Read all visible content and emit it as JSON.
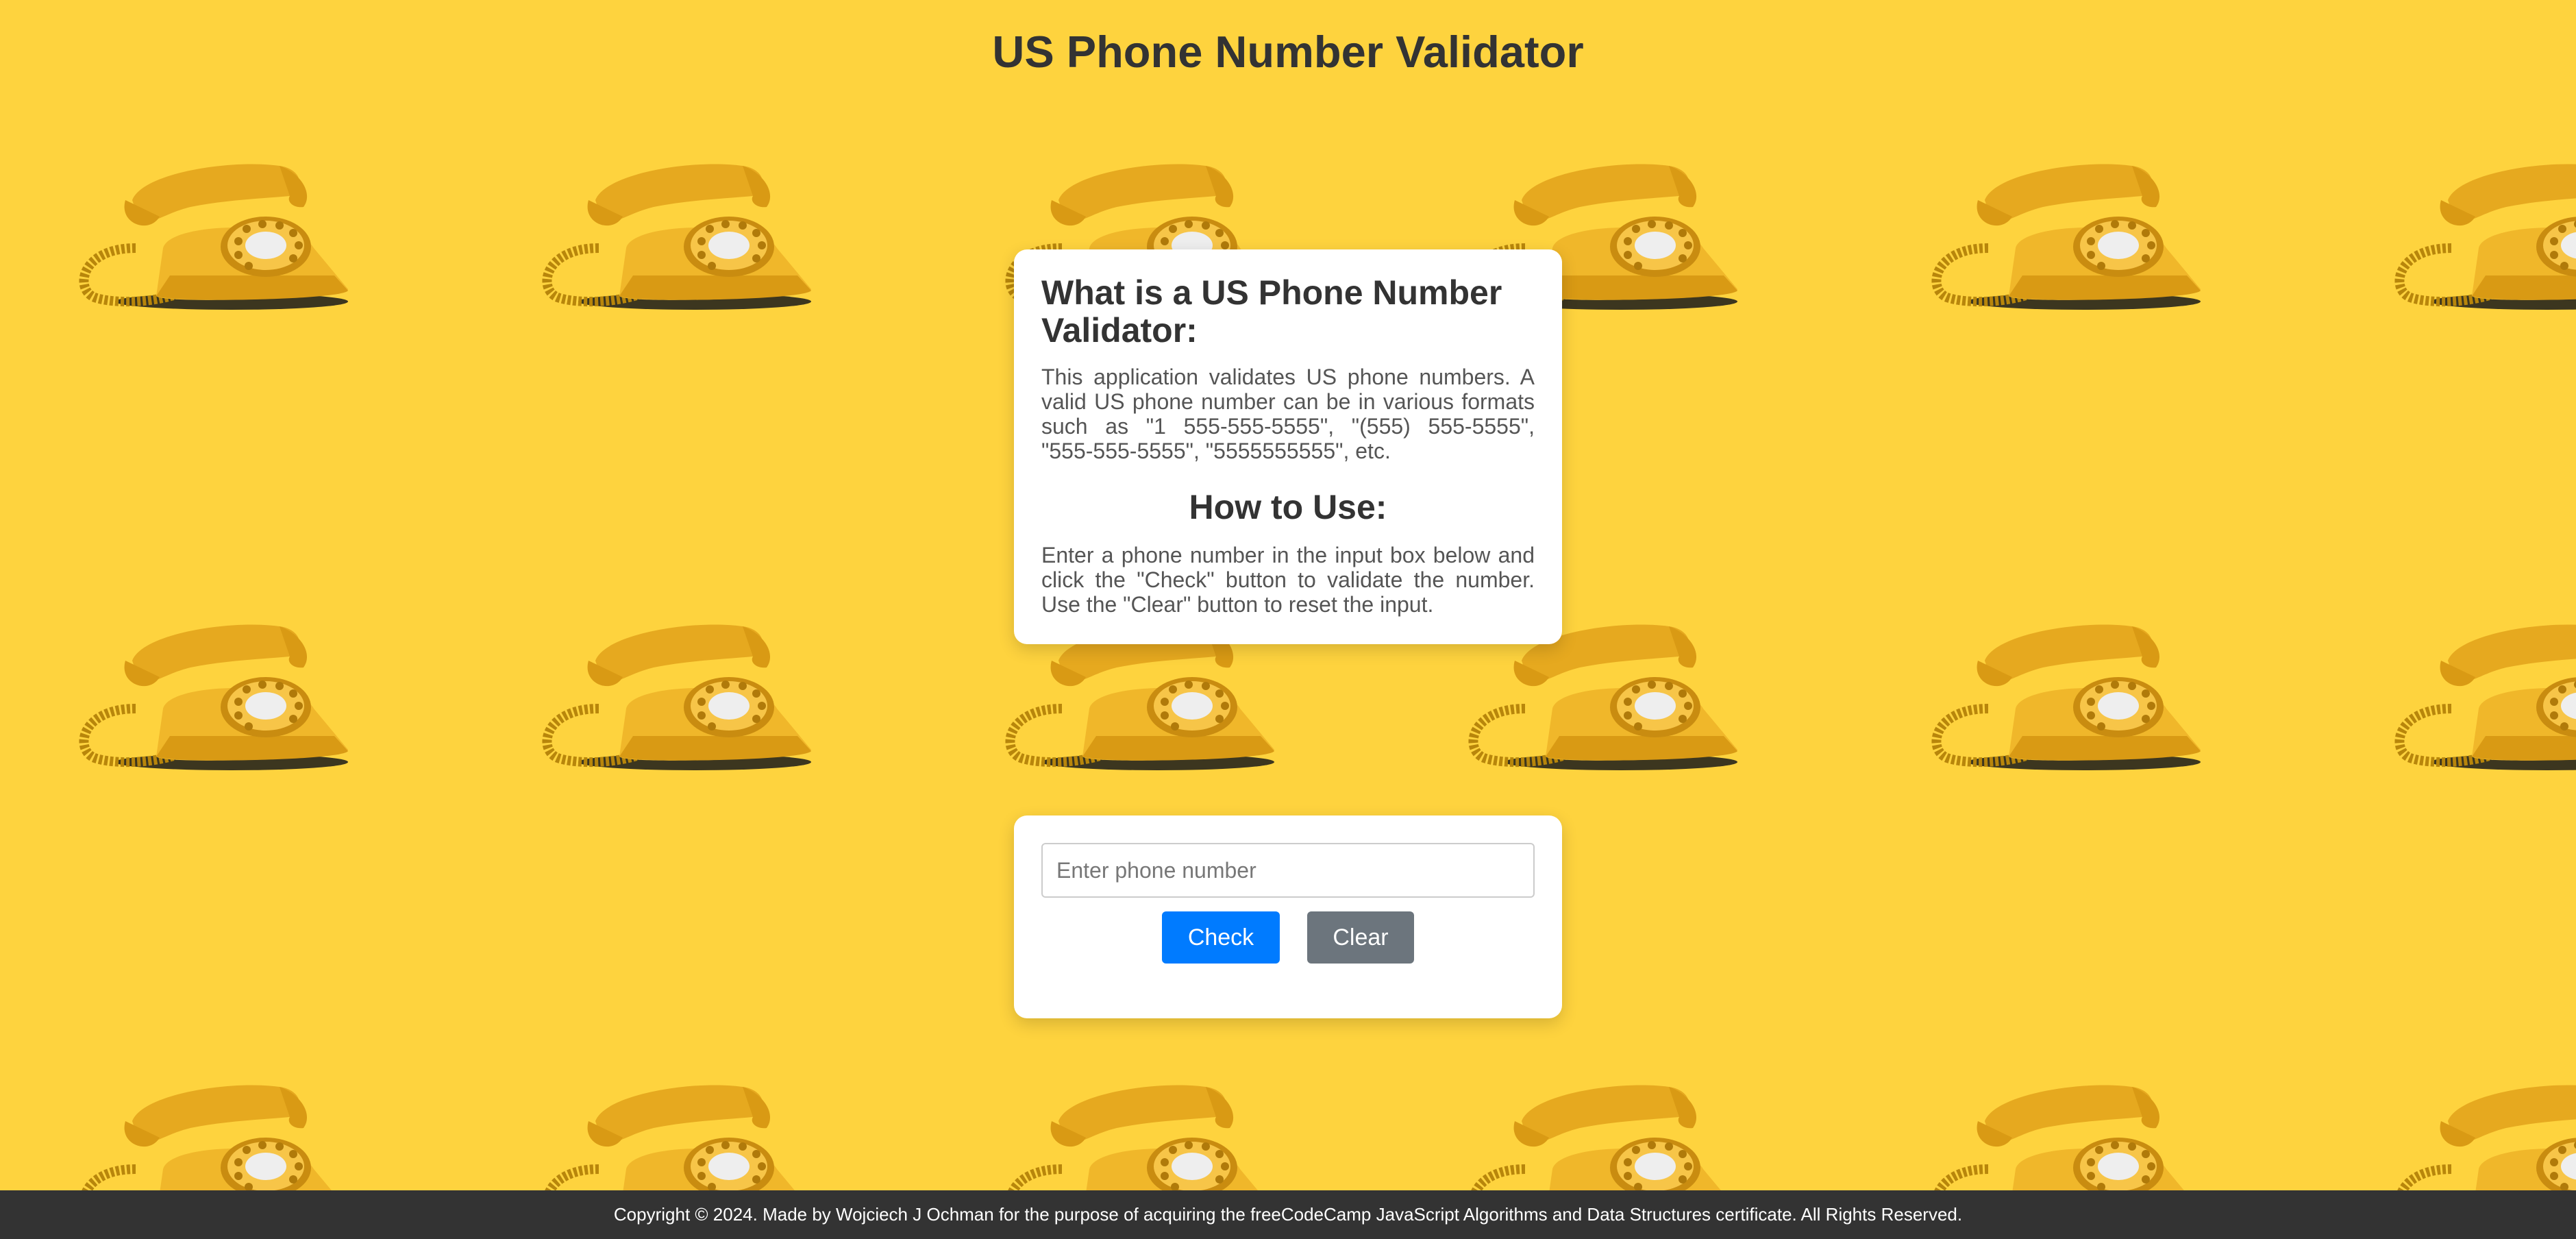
{
  "page": {
    "title": "US Phone Number Validator",
    "background_color": "#fed33e",
    "background_pattern_icon": "rotary-telephone-icon"
  },
  "info": {
    "heading": "What is a US Phone Number Validator:",
    "description": "This application validates US phone numbers. A valid US phone number can be in various formats such as \"1 555-555-5555\", \"(555) 555-5555\", \"555-555-5555\", \"5555555555\", etc.",
    "howto_heading": "How to Use:",
    "howto_text": "Enter a phone number in the input box below and click the \"Check\" button to validate the number. Use the \"Clear\" button to reset the input."
  },
  "form": {
    "input_placeholder": "Enter phone number",
    "input_value": "",
    "check_label": "Check",
    "clear_label": "Clear",
    "check_color": "#007bff",
    "clear_color": "#6c757d"
  },
  "footer": {
    "text": "Copyright © 2024. Made by Wojciech J Ochman for the purpose of acquiring the freeCodeCamp JavaScript Algorithms and Data Structures certificate. All Rights Reserved."
  }
}
